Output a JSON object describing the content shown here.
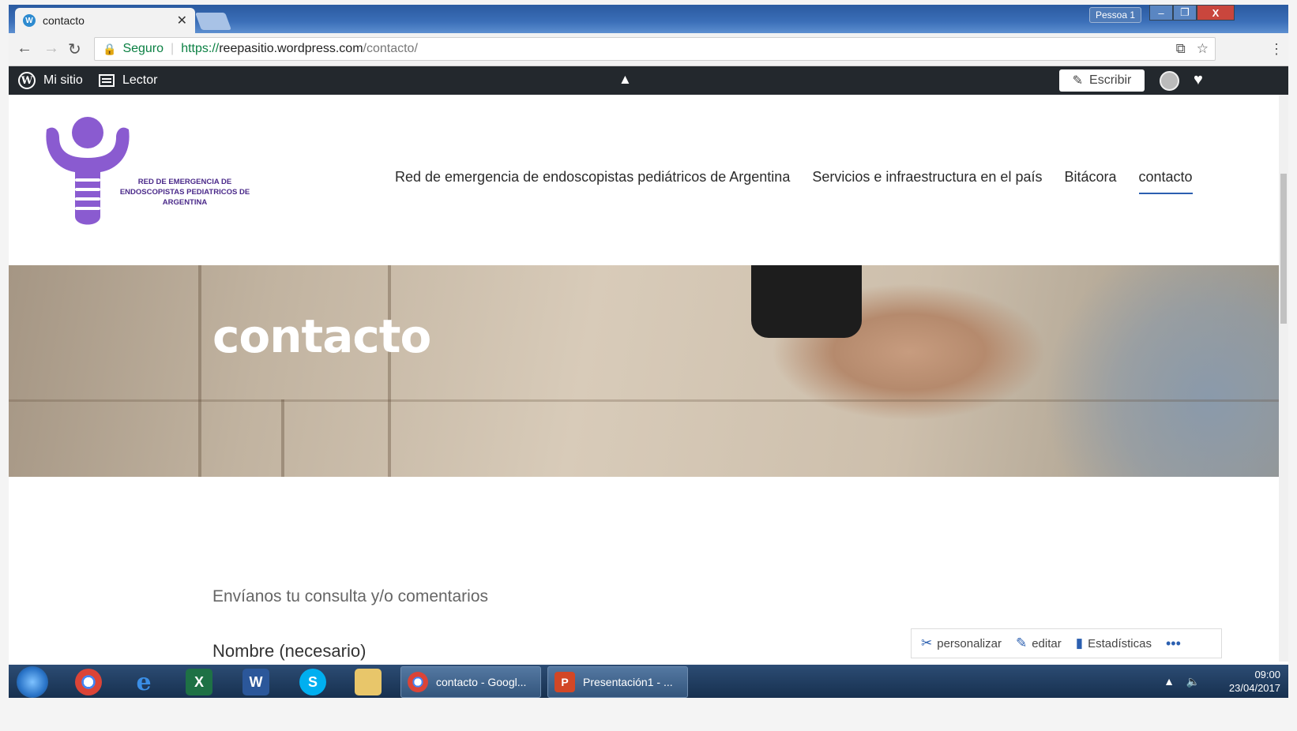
{
  "browser": {
    "tab_title": "contacto",
    "profile": "Pessoa 1",
    "secure_label": "Seguro",
    "url_scheme": "https://",
    "url_host": "reepasitio.wordpress.com",
    "url_path": "/contacto/"
  },
  "wpbar": {
    "my_site": "Mi sitio",
    "reader": "Lector",
    "write": "Escribir"
  },
  "site": {
    "logo_text": "RED DE EMERGENCIA DE ENDOSCOPISTAS PEDIATRICOS DE ARGENTINA",
    "nav": [
      "Red de emergencia de endoscopistas pediátricos de Argentina",
      "Servicios e infraestructura en el país",
      "Bitácora",
      "contacto"
    ],
    "hero_title": "contacto",
    "intro": "Envíanos tu consulta y/o comentarios",
    "name_label": "Nombre (necesario)"
  },
  "actionbar": {
    "customize": "personalizar",
    "edit": "editar",
    "stats": "Estadísticas"
  },
  "taskbar": {
    "chrome_task": "contacto - Googl...",
    "ppt_task": "Presentación1 - ...",
    "time": "09:00",
    "date": "23/04/2017"
  },
  "colors": {
    "accent": "#2b5fb0",
    "wp_bar": "#23282d",
    "logo_purple": "#8a5bd0"
  }
}
